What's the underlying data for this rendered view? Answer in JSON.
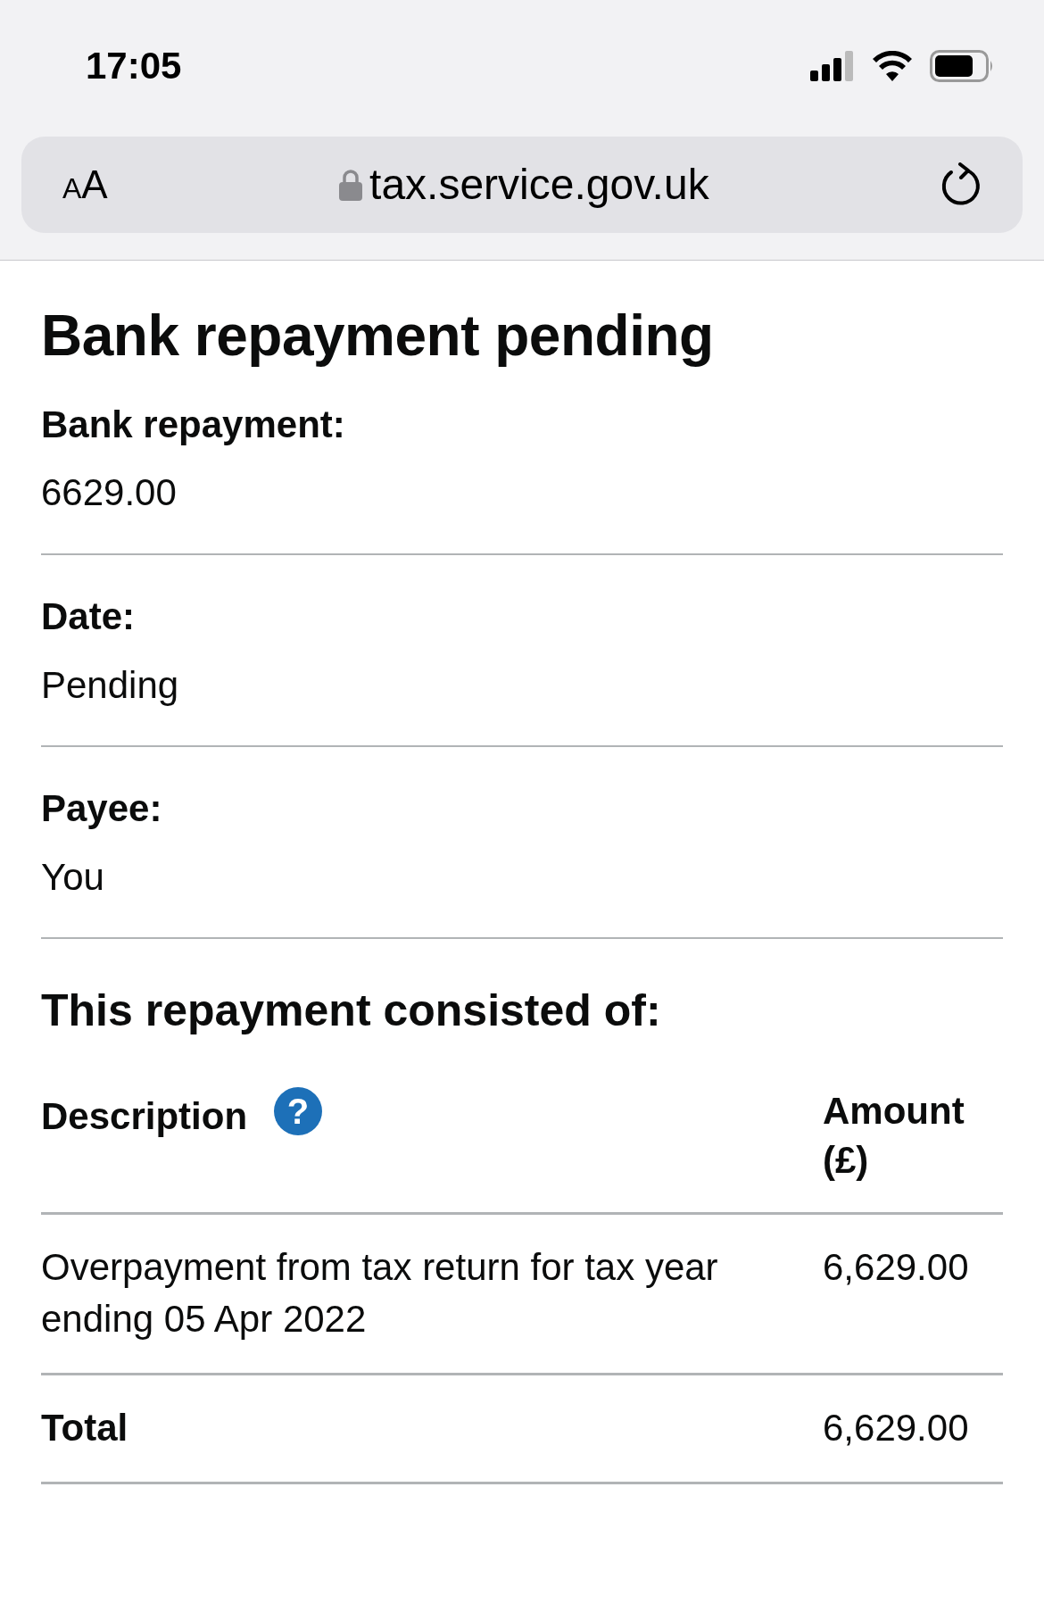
{
  "status_bar": {
    "time": "17:05"
  },
  "browser": {
    "text_size_button": "AA",
    "url": "tax.service.gov.uk"
  },
  "page": {
    "title": "Bank repayment pending",
    "summary": [
      {
        "label": "Bank repayment:",
        "value": "6629.00"
      },
      {
        "label": "Date:",
        "value": "Pending"
      },
      {
        "label": "Payee:",
        "value": "You"
      }
    ],
    "table": {
      "caption": "This repayment consisted of:",
      "help": "?",
      "columns": [
        "Description",
        "Amount (£)"
      ],
      "rows": [
        {
          "description": "Overpayment from tax return for tax year ending 05 Apr 2022",
          "amount": "6,629.00"
        }
      ],
      "total": {
        "label": "Total",
        "amount": "6,629.00"
      }
    }
  }
}
